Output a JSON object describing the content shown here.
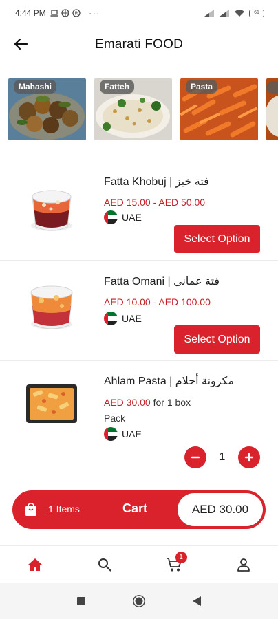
{
  "status_bar": {
    "time": "4:44 PM",
    "extra": "···",
    "battery": "61",
    "icons": [
      "laptop-icon",
      "globe-icon",
      "registered-icon",
      "signal-icon",
      "signal-icon",
      "wifi-icon",
      "battery-icon"
    ]
  },
  "header": {
    "title": "Emarati FOOD",
    "back_icon": "arrow-left-icon"
  },
  "categories": [
    {
      "label": "Mahashi"
    },
    {
      "label": "Fatteh"
    },
    {
      "label": "Pasta"
    }
  ],
  "products": [
    {
      "name": "Fatta Khobuj | فتة خبز",
      "price": "AED 15.00 - AED 50.00",
      "country": "UAE",
      "button": "Select Option"
    },
    {
      "name": "Fatta Omani | فتة عماني",
      "price": "AED 10.00 - AED 100.00",
      "country": "UAE",
      "button": "Select Option"
    },
    {
      "name": "Ahlam Pasta | مكرونة أحلام",
      "price": "AED 30.00",
      "price_suffix": "for 1 box",
      "pack": "Pack",
      "country": "UAE",
      "quantity": "1"
    }
  ],
  "cart": {
    "items": "1 Items",
    "label": "Cart",
    "total": "AED 30.00"
  },
  "bottom_nav": {
    "items": [
      "home-icon",
      "search-icon",
      "cart-icon",
      "person-icon"
    ],
    "cart_badge": "1"
  },
  "colors": {
    "accent": "#d9222b",
    "price": "#c8202a"
  }
}
